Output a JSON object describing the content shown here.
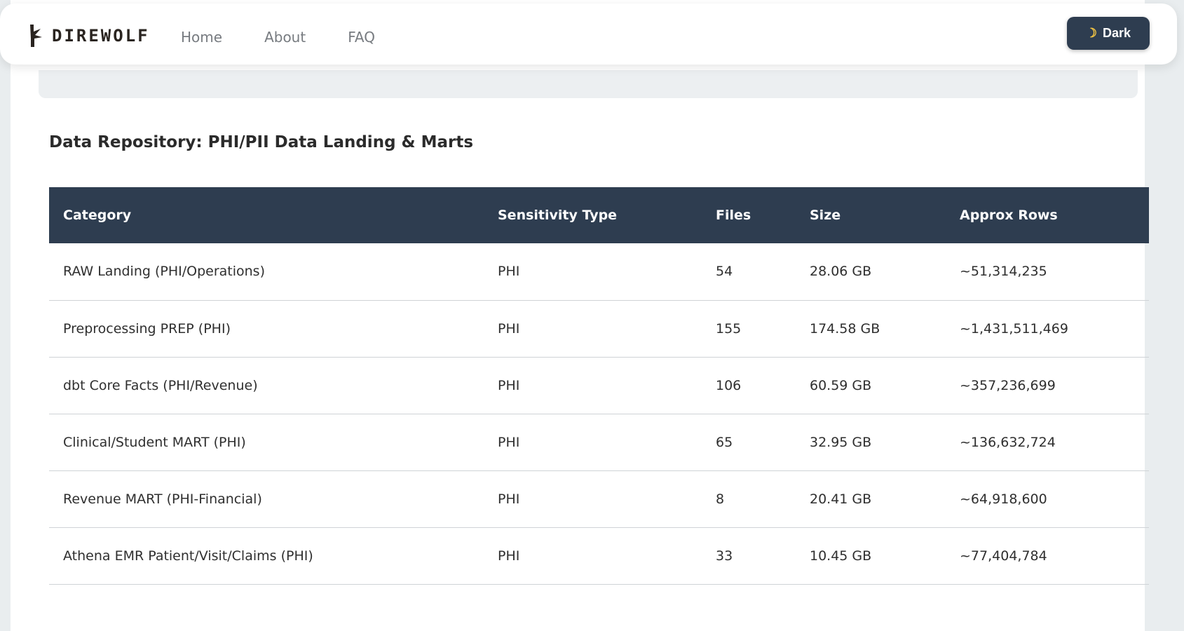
{
  "brand": {
    "name": "DIREWOLF"
  },
  "nav": {
    "links": [
      "Home",
      "About",
      "FAQ"
    ]
  },
  "theme_toggle": {
    "icon": "moon-icon",
    "label": "Dark"
  },
  "section": {
    "title": "Data Repository: PHI/PII Data Landing & Marts"
  },
  "table": {
    "headers": [
      "Category",
      "Sensitivity Type",
      "Files",
      "Size",
      "Approx Rows"
    ],
    "rows": [
      [
        "RAW Landing (PHI/Operations)",
        "PHI",
        "54",
        "28.06 GB",
        "~51,314,235"
      ],
      [
        "Preprocessing PREP (PHI)",
        "PHI",
        "155",
        "174.58 GB",
        "~1,431,511,469"
      ],
      [
        "dbt Core Facts (PHI/Revenue)",
        "PHI",
        "106",
        "60.59 GB",
        "~357,236,699"
      ],
      [
        "Clinical/Student MART (PHI)",
        "PHI",
        "65",
        "32.95 GB",
        "~136,632,724"
      ],
      [
        "Revenue MART (PHI-Financial)",
        "PHI",
        "8",
        "20.41 GB",
        "~64,918,600"
      ],
      [
        "Athena EMR Patient/Visit/Claims (PHI)",
        "PHI",
        "33",
        "10.45 GB",
        "~77,404,784"
      ]
    ]
  },
  "colors": {
    "header_bg": "#2e3d50",
    "page_bg": "#e9edef",
    "accent_moon": "#f4c542"
  }
}
